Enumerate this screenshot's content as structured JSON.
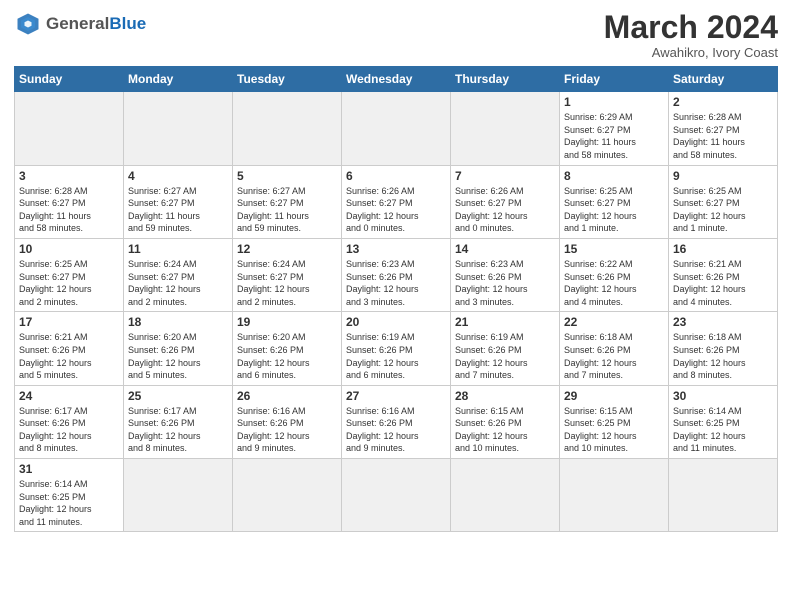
{
  "header": {
    "logo_general": "General",
    "logo_blue": "Blue",
    "month_year": "March 2024",
    "location": "Awahikro, Ivory Coast"
  },
  "days_of_week": [
    "Sunday",
    "Monday",
    "Tuesday",
    "Wednesday",
    "Thursday",
    "Friday",
    "Saturday"
  ],
  "weeks": [
    [
      {
        "day": "",
        "info": "",
        "empty": true
      },
      {
        "day": "",
        "info": "",
        "empty": true
      },
      {
        "day": "",
        "info": "",
        "empty": true
      },
      {
        "day": "",
        "info": "",
        "empty": true
      },
      {
        "day": "",
        "info": "",
        "empty": true
      },
      {
        "day": "1",
        "info": "Sunrise: 6:29 AM\nSunset: 6:27 PM\nDaylight: 11 hours\nand 58 minutes."
      },
      {
        "day": "2",
        "info": "Sunrise: 6:28 AM\nSunset: 6:27 PM\nDaylight: 11 hours\nand 58 minutes."
      }
    ],
    [
      {
        "day": "3",
        "info": "Sunrise: 6:28 AM\nSunset: 6:27 PM\nDaylight: 11 hours\nand 58 minutes."
      },
      {
        "day": "4",
        "info": "Sunrise: 6:27 AM\nSunset: 6:27 PM\nDaylight: 11 hours\nand 59 minutes."
      },
      {
        "day": "5",
        "info": "Sunrise: 6:27 AM\nSunset: 6:27 PM\nDaylight: 11 hours\nand 59 minutes."
      },
      {
        "day": "6",
        "info": "Sunrise: 6:26 AM\nSunset: 6:27 PM\nDaylight: 12 hours\nand 0 minutes."
      },
      {
        "day": "7",
        "info": "Sunrise: 6:26 AM\nSunset: 6:27 PM\nDaylight: 12 hours\nand 0 minutes."
      },
      {
        "day": "8",
        "info": "Sunrise: 6:25 AM\nSunset: 6:27 PM\nDaylight: 12 hours\nand 1 minute."
      },
      {
        "day": "9",
        "info": "Sunrise: 6:25 AM\nSunset: 6:27 PM\nDaylight: 12 hours\nand 1 minute."
      }
    ],
    [
      {
        "day": "10",
        "info": "Sunrise: 6:25 AM\nSunset: 6:27 PM\nDaylight: 12 hours\nand 2 minutes."
      },
      {
        "day": "11",
        "info": "Sunrise: 6:24 AM\nSunset: 6:27 PM\nDaylight: 12 hours\nand 2 minutes."
      },
      {
        "day": "12",
        "info": "Sunrise: 6:24 AM\nSunset: 6:27 PM\nDaylight: 12 hours\nand 2 minutes."
      },
      {
        "day": "13",
        "info": "Sunrise: 6:23 AM\nSunset: 6:26 PM\nDaylight: 12 hours\nand 3 minutes."
      },
      {
        "day": "14",
        "info": "Sunrise: 6:23 AM\nSunset: 6:26 PM\nDaylight: 12 hours\nand 3 minutes."
      },
      {
        "day": "15",
        "info": "Sunrise: 6:22 AM\nSunset: 6:26 PM\nDaylight: 12 hours\nand 4 minutes."
      },
      {
        "day": "16",
        "info": "Sunrise: 6:21 AM\nSunset: 6:26 PM\nDaylight: 12 hours\nand 4 minutes."
      }
    ],
    [
      {
        "day": "17",
        "info": "Sunrise: 6:21 AM\nSunset: 6:26 PM\nDaylight: 12 hours\nand 5 minutes."
      },
      {
        "day": "18",
        "info": "Sunrise: 6:20 AM\nSunset: 6:26 PM\nDaylight: 12 hours\nand 5 minutes."
      },
      {
        "day": "19",
        "info": "Sunrise: 6:20 AM\nSunset: 6:26 PM\nDaylight: 12 hours\nand 6 minutes."
      },
      {
        "day": "20",
        "info": "Sunrise: 6:19 AM\nSunset: 6:26 PM\nDaylight: 12 hours\nand 6 minutes."
      },
      {
        "day": "21",
        "info": "Sunrise: 6:19 AM\nSunset: 6:26 PM\nDaylight: 12 hours\nand 7 minutes."
      },
      {
        "day": "22",
        "info": "Sunrise: 6:18 AM\nSunset: 6:26 PM\nDaylight: 12 hours\nand 7 minutes."
      },
      {
        "day": "23",
        "info": "Sunrise: 6:18 AM\nSunset: 6:26 PM\nDaylight: 12 hours\nand 8 minutes."
      }
    ],
    [
      {
        "day": "24",
        "info": "Sunrise: 6:17 AM\nSunset: 6:26 PM\nDaylight: 12 hours\nand 8 minutes."
      },
      {
        "day": "25",
        "info": "Sunrise: 6:17 AM\nSunset: 6:26 PM\nDaylight: 12 hours\nand 8 minutes."
      },
      {
        "day": "26",
        "info": "Sunrise: 6:16 AM\nSunset: 6:26 PM\nDaylight: 12 hours\nand 9 minutes."
      },
      {
        "day": "27",
        "info": "Sunrise: 6:16 AM\nSunset: 6:26 PM\nDaylight: 12 hours\nand 9 minutes."
      },
      {
        "day": "28",
        "info": "Sunrise: 6:15 AM\nSunset: 6:26 PM\nDaylight: 12 hours\nand 10 minutes."
      },
      {
        "day": "29",
        "info": "Sunrise: 6:15 AM\nSunset: 6:25 PM\nDaylight: 12 hours\nand 10 minutes."
      },
      {
        "day": "30",
        "info": "Sunrise: 6:14 AM\nSunset: 6:25 PM\nDaylight: 12 hours\nand 11 minutes."
      }
    ],
    [
      {
        "day": "31",
        "info": "Sunrise: 6:14 AM\nSunset: 6:25 PM\nDaylight: 12 hours\nand 11 minutes."
      },
      {
        "day": "",
        "info": "",
        "empty": true
      },
      {
        "day": "",
        "info": "",
        "empty": true
      },
      {
        "day": "",
        "info": "",
        "empty": true
      },
      {
        "day": "",
        "info": "",
        "empty": true
      },
      {
        "day": "",
        "info": "",
        "empty": true
      },
      {
        "day": "",
        "info": "",
        "empty": true
      }
    ]
  ]
}
